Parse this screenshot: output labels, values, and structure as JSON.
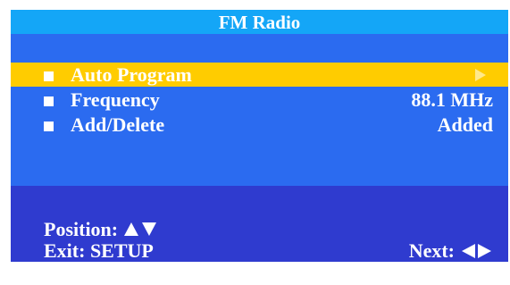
{
  "title": "FM Radio",
  "menu": {
    "items": [
      {
        "label": "Auto Program",
        "value": "",
        "selected": true,
        "icon": "arrow-right-icon"
      },
      {
        "label": "Frequency",
        "value": "88.1 MHz",
        "selected": false
      },
      {
        "label": "Add/Delete",
        "value": "Added",
        "selected": false
      }
    ]
  },
  "footer": {
    "position_label": "Position:",
    "exit_label": "Exit: SETUP",
    "next_label": "Next:",
    "icons": [
      "up-arrow-icon",
      "down-arrow-icon",
      "left-arrow-icon",
      "right-arrow-icon"
    ]
  },
  "colors": {
    "title_bar": "#14a6f7",
    "panel": "#2b6bf0",
    "selected_row": "#ffcc00",
    "footer": "#2f3bcf",
    "text": "#ffffff"
  }
}
